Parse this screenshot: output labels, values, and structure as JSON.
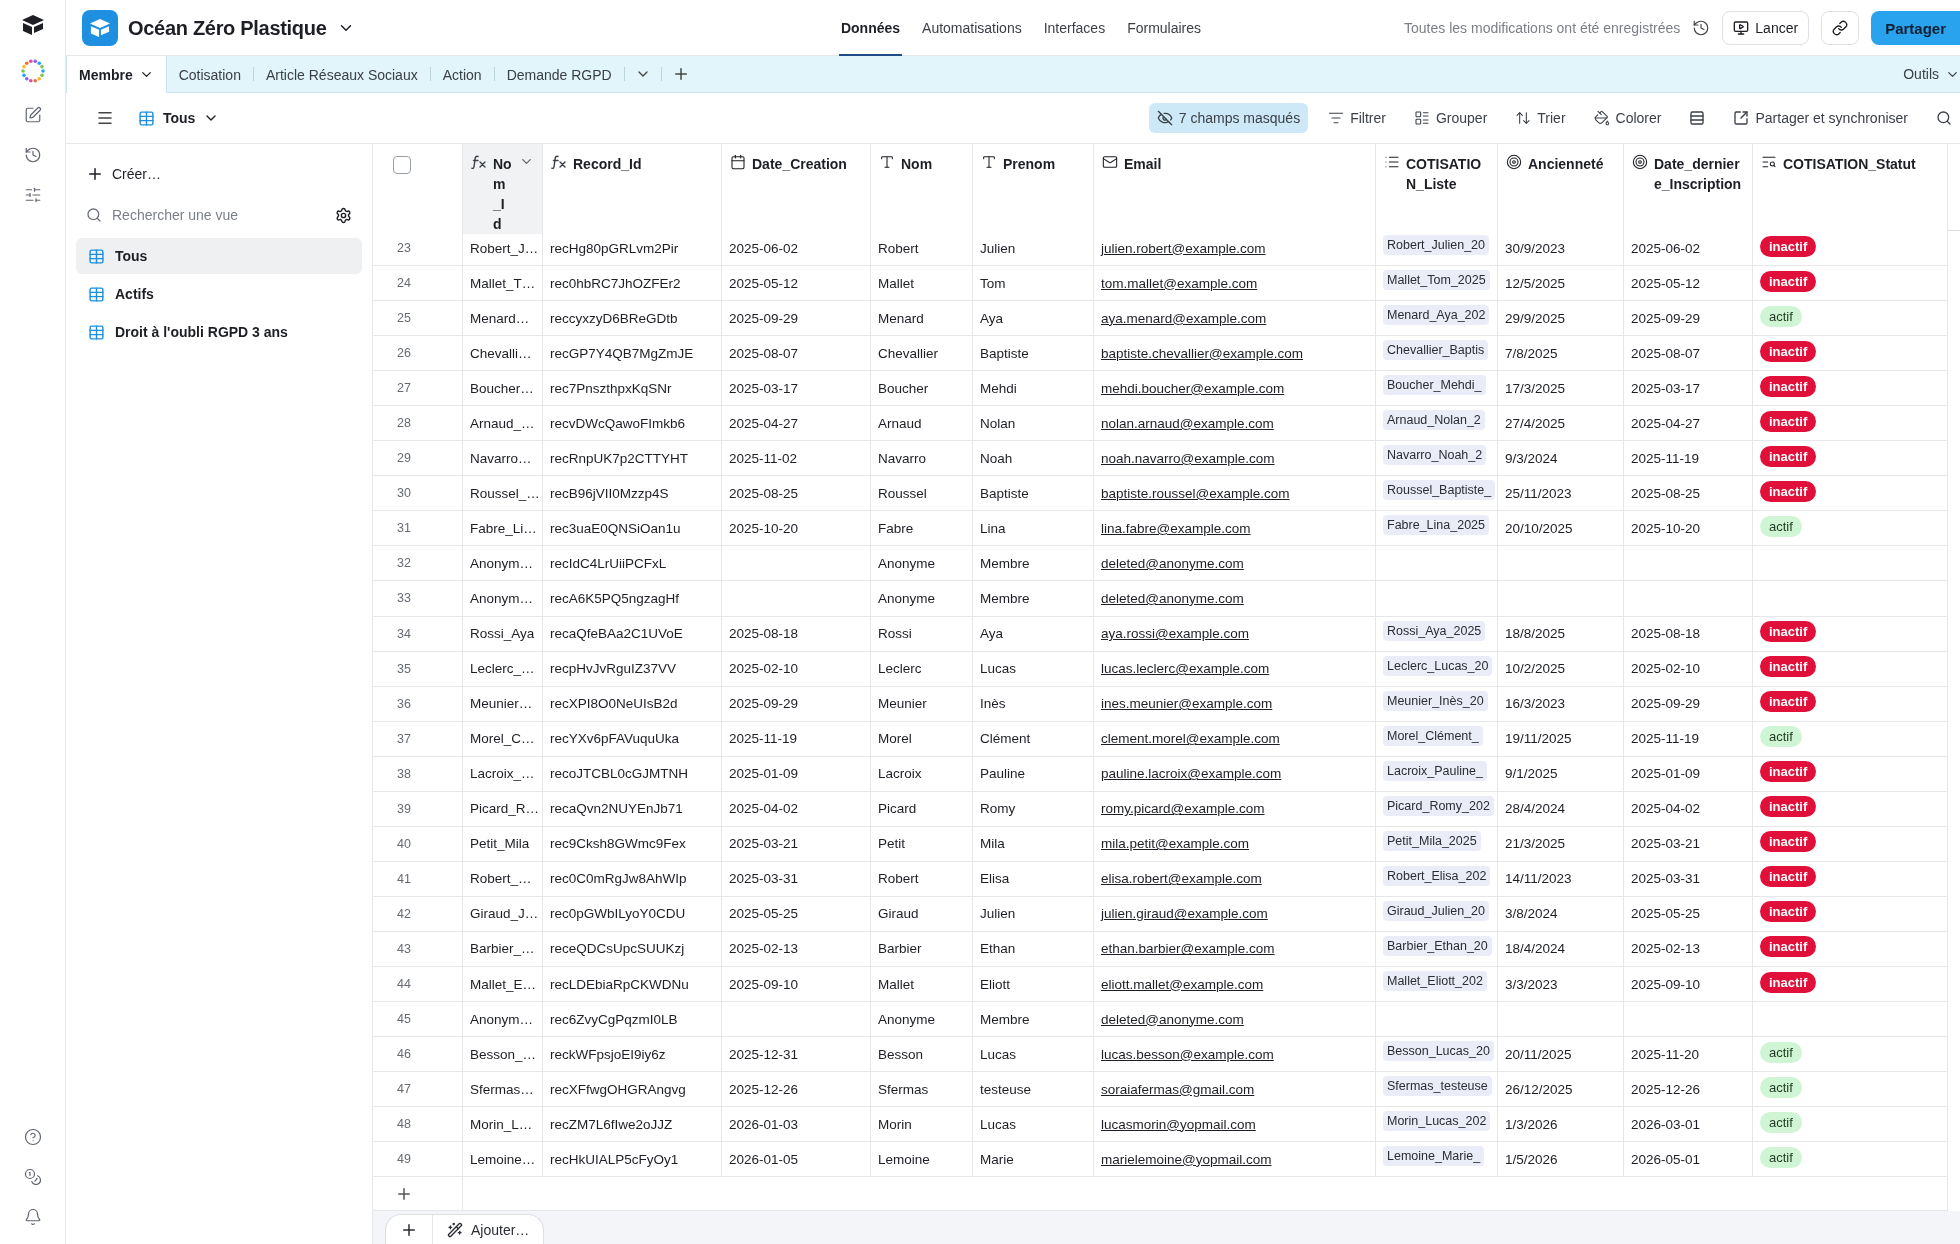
{
  "app": {
    "title": "Océan Zéro Plastique"
  },
  "nav": [
    {
      "label": "Données",
      "selected": true
    },
    {
      "label": "Automatisations",
      "selected": false
    },
    {
      "label": "Interfaces",
      "selected": false
    },
    {
      "label": "Formulaires",
      "selected": false
    }
  ],
  "save_status": "Toutes les modifications ont été enregistrées",
  "actions": {
    "launch": "Lancer",
    "share": "Partager"
  },
  "tables": [
    {
      "label": "Membre",
      "selected": true
    },
    {
      "label": "Cotisation",
      "selected": false
    },
    {
      "label": "Article Réseaux Sociaux",
      "selected": false
    },
    {
      "label": "Action",
      "selected": false
    },
    {
      "label": "Demande RGPD",
      "selected": false
    }
  ],
  "tools": "Outils",
  "view_toolbar": {
    "view": "Tous",
    "hidden_fields": "7 champs masqués",
    "buttons": [
      {
        "label": "Filtrer",
        "kind": "filter"
      },
      {
        "label": "Grouper",
        "kind": "group"
      },
      {
        "label": "Trier",
        "kind": "sort"
      },
      {
        "label": "Colorer",
        "kind": "color"
      }
    ],
    "sync": "Partager et synchroniser"
  },
  "sidebar": {
    "create": "Créer…",
    "search": {
      "placeholder": "Rechercher une vue"
    },
    "views": [
      {
        "label": "Tous",
        "selected": true
      },
      {
        "label": "Actifs",
        "selected": false
      },
      {
        "label": "Droit à l'oubli RGPD 3 ans",
        "selected": false
      }
    ]
  },
  "table": {
    "select_all_checked": false,
    "columns": [
      {
        "label": "Nom_Id",
        "kind": "formula",
        "highlighted": true
      },
      {
        "label": "Record_Id",
        "kind": "formula",
        "highlighted": false
      },
      {
        "label": "Date_Creation",
        "kind": "date",
        "highlighted": false
      },
      {
        "label": "Nom",
        "kind": "text",
        "highlighted": false
      },
      {
        "label": "Prenom",
        "kind": "text",
        "highlighted": false
      },
      {
        "label": "Email",
        "kind": "email",
        "highlighted": false
      },
      {
        "label": "COTISATION_Liste",
        "kind": "link",
        "highlighted": false
      },
      {
        "label": "Ancienneté",
        "kind": "rollup",
        "highlighted": false
      },
      {
        "label": "Date_derniere_Inscription",
        "kind": "rollup",
        "highlighted": false
      },
      {
        "label": "COTISATION_Statut",
        "kind": "lookup",
        "highlighted": false
      }
    ],
    "rows": [
      {
        "number": "23",
        "nom_id": "Robert_J…",
        "record_id": "recHg80pGRLvm2Pir",
        "date_creation": "2025-06-02",
        "nom": "Robert",
        "prenom": "Julien",
        "email": "julien.robert@example.com",
        "liste": "Robert_Julien_20",
        "anciennete": "30/9/2023",
        "date_derniere": "2025-06-02",
        "statut": {
          "label": "inactif",
          "color": "#e0103a"
        }
      },
      {
        "number": "24",
        "nom_id": "Mallet_T…",
        "record_id": "rec0hbRC7JhOZFEr2",
        "date_creation": "2025-05-12",
        "nom": "Mallet",
        "prenom": "Tom",
        "email": "tom.mallet@example.com",
        "liste": "Mallet_Tom_2025",
        "anciennete": "12/5/2025",
        "date_derniere": "2025-05-12",
        "statut": {
          "label": "inactif",
          "color": "#e0103a"
        }
      },
      {
        "number": "25",
        "nom_id": "Menard…",
        "record_id": "reccyxzyD6BReGDtb",
        "date_creation": "2025-09-29",
        "nom": "Menard",
        "prenom": "Aya",
        "email": "aya.menard@example.com",
        "liste": "Menard_Aya_202",
        "anciennete": "29/9/2025",
        "date_derniere": "2025-09-29",
        "statut": {
          "label": "actif",
          "color": "#cff5d4"
        }
      },
      {
        "number": "26",
        "nom_id": "Chevalli…",
        "record_id": "recGP7Y4QB7MgZmJE",
        "date_creation": "2025-08-07",
        "nom": "Chevallier",
        "prenom": "Baptiste",
        "email": "baptiste.chevallier@example.com",
        "liste": "Chevallier_Baptis",
        "anciennete": "7/8/2025",
        "date_derniere": "2025-08-07",
        "statut": {
          "label": "inactif",
          "color": "#e0103a"
        }
      },
      {
        "number": "27",
        "nom_id": "Boucher…",
        "record_id": "rec7PnszthpxKqSNr",
        "date_creation": "2025-03-17",
        "nom": "Boucher",
        "prenom": "Mehdi",
        "email": "mehdi.boucher@example.com",
        "liste": "Boucher_Mehdi_",
        "anciennete": "17/3/2025",
        "date_derniere": "2025-03-17",
        "statut": {
          "label": "inactif",
          "color": "#e0103a"
        }
      },
      {
        "number": "28",
        "nom_id": "Arnaud_…",
        "record_id": "recvDWcQawoFImkb6",
        "date_creation": "2025-04-27",
        "nom": "Arnaud",
        "prenom": "Nolan",
        "email": "nolan.arnaud@example.com",
        "liste": "Arnaud_Nolan_2",
        "anciennete": "27/4/2025",
        "date_derniere": "2025-04-27",
        "statut": {
          "label": "inactif",
          "color": "#e0103a"
        }
      },
      {
        "number": "29",
        "nom_id": "Navarro…",
        "record_id": "recRnpUK7p2CTTYHT",
        "date_creation": "2025-11-02",
        "nom": "Navarro",
        "prenom": "Noah",
        "email": "noah.navarro@example.com",
        "liste": "Navarro_Noah_2",
        "anciennete": "9/3/2024",
        "date_derniere": "2025-11-19",
        "statut": {
          "label": "inactif",
          "color": "#e0103a"
        }
      },
      {
        "number": "30",
        "nom_id": "Roussel_…",
        "record_id": "recB96jVII0Mzzp4S",
        "date_creation": "2025-08-25",
        "nom": "Roussel",
        "prenom": "Baptiste",
        "email": "baptiste.roussel@example.com",
        "liste": "Roussel_Baptiste_",
        "anciennete": "25/11/2023",
        "date_derniere": "2025-08-25",
        "statut": {
          "label": "inactif",
          "color": "#e0103a"
        }
      },
      {
        "number": "31",
        "nom_id": "Fabre_Li…",
        "record_id": "rec3uaE0QNSiOan1u",
        "date_creation": "2025-10-20",
        "nom": "Fabre",
        "prenom": "Lina",
        "email": "lina.fabre@example.com",
        "liste": "Fabre_Lina_2025",
        "anciennete": "20/10/2025",
        "date_derniere": "2025-10-20",
        "statut": {
          "label": "actif",
          "color": "#cff5d4"
        }
      },
      {
        "number": "32",
        "nom_id": "Anonym…",
        "record_id": "recIdC4LrUiiPCFxL",
        "nom": "Anonyme",
        "prenom": "Membre",
        "email": "deleted@anonyme.com"
      },
      {
        "number": "33",
        "nom_id": "Anonym…",
        "record_id": "recA6K5PQ5ngzagHf",
        "nom": "Anonyme",
        "prenom": "Membre",
        "email": "deleted@anonyme.com"
      },
      {
        "number": "34",
        "nom_id": "Rossi_Aya",
        "record_id": "recaQfeBAa2C1UVoE",
        "date_creation": "2025-08-18",
        "nom": "Rossi",
        "prenom": "Aya",
        "email": "aya.rossi@example.com",
        "liste": "Rossi_Aya_2025",
        "anciennete": "18/8/2025",
        "date_derniere": "2025-08-18",
        "statut": {
          "label": "inactif",
          "color": "#e0103a"
        }
      },
      {
        "number": "35",
        "nom_id": "Leclerc_…",
        "record_id": "recpHvJvRguIZ37VV",
        "date_creation": "2025-02-10",
        "nom": "Leclerc",
        "prenom": "Lucas",
        "email": "lucas.leclerc@example.com",
        "liste": "Leclerc_Lucas_20",
        "anciennete": "10/2/2025",
        "date_derniere": "2025-02-10",
        "statut": {
          "label": "inactif",
          "color": "#e0103a"
        }
      },
      {
        "number": "36",
        "nom_id": "Meunier…",
        "record_id": "recXPI8O0NeUIsB2d",
        "date_creation": "2025-09-29",
        "nom": "Meunier",
        "prenom": "Inès",
        "email": "ines.meunier@example.com",
        "liste": "Meunier_Inès_20",
        "anciennete": "16/3/2023",
        "date_derniere": "2025-09-29",
        "statut": {
          "label": "inactif",
          "color": "#e0103a"
        }
      },
      {
        "number": "37",
        "nom_id": "Morel_C…",
        "record_id": "recYXv6pFAVuquUka",
        "date_creation": "2025-11-19",
        "nom": "Morel",
        "prenom": "Clément",
        "email": "clement.morel@example.com",
        "liste": "Morel_Clément_",
        "anciennete": "19/11/2025",
        "date_derniere": "2025-11-19",
        "statut": {
          "label": "actif",
          "color": "#cff5d4"
        }
      },
      {
        "number": "38",
        "nom_id": "Lacroix_…",
        "record_id": "recoJTCBL0cGJMTNH",
        "date_creation": "2025-01-09",
        "nom": "Lacroix",
        "prenom": "Pauline",
        "email": "pauline.lacroix@example.com",
        "liste": "Lacroix_Pauline_",
        "anciennete": "9/1/2025",
        "date_derniere": "2025-01-09",
        "statut": {
          "label": "inactif",
          "color": "#e0103a"
        }
      },
      {
        "number": "39",
        "nom_id": "Picard_R…",
        "record_id": "recaQvn2NUYEnJb71",
        "date_creation": "2025-04-02",
        "nom": "Picard",
        "prenom": "Romy",
        "email": "romy.picard@example.com",
        "liste": "Picard_Romy_202",
        "anciennete": "28/4/2024",
        "date_derniere": "2025-04-02",
        "statut": {
          "label": "inactif",
          "color": "#e0103a"
        }
      },
      {
        "number": "40",
        "nom_id": "Petit_Mila",
        "record_id": "rec9Cksh8GWmc9Fex",
        "date_creation": "2025-03-21",
        "nom": "Petit",
        "prenom": "Mila",
        "email": "mila.petit@example.com",
        "liste": "Petit_Mila_2025",
        "anciennete": "21/3/2025",
        "date_derniere": "2025-03-21",
        "statut": {
          "label": "inactif",
          "color": "#e0103a"
        }
      },
      {
        "number": "41",
        "nom_id": "Robert_…",
        "record_id": "rec0C0mRgJw8AhWIp",
        "date_creation": "2025-03-31",
        "nom": "Robert",
        "prenom": "Elisa",
        "email": "elisa.robert@example.com",
        "liste": "Robert_Elisa_202",
        "anciennete": "14/11/2023",
        "date_derniere": "2025-03-31",
        "statut": {
          "label": "inactif",
          "color": "#e0103a"
        }
      },
      {
        "number": "42",
        "nom_id": "Giraud_J…",
        "record_id": "rec0pGWbILyoY0CDU",
        "date_creation": "2025-05-25",
        "nom": "Giraud",
        "prenom": "Julien",
        "email": "julien.giraud@example.com",
        "liste": "Giraud_Julien_20",
        "anciennete": "3/8/2024",
        "date_derniere": "2025-05-25",
        "statut": {
          "label": "inactif",
          "color": "#e0103a"
        }
      },
      {
        "number": "43",
        "nom_id": "Barbier_…",
        "record_id": "receQDCsUpcSUUKzj",
        "date_creation": "2025-02-13",
        "nom": "Barbier",
        "prenom": "Ethan",
        "email": "ethan.barbier@example.com",
        "liste": "Barbier_Ethan_20",
        "anciennete": "18/4/2024",
        "date_derniere": "2025-02-13",
        "statut": {
          "label": "inactif",
          "color": "#e0103a"
        }
      },
      {
        "number": "44",
        "nom_id": "Mallet_E…",
        "record_id": "recLDEbiaRpCKWDNu",
        "date_creation": "2025-09-10",
        "nom": "Mallet",
        "prenom": "Eliott",
        "email": "eliott.mallet@example.com",
        "liste": "Mallet_Eliott_202",
        "anciennete": "3/3/2023",
        "date_derniere": "2025-09-10",
        "statut": {
          "label": "inactif",
          "color": "#e0103a"
        }
      },
      {
        "number": "45",
        "nom_id": "Anonym…",
        "record_id": "rec6ZvyCgPqzmI0LB",
        "nom": "Anonyme",
        "prenom": "Membre",
        "email": "deleted@anonyme.com"
      },
      {
        "number": "46",
        "nom_id": "Besson_…",
        "record_id": "reckWFpsjoEI9iy6z",
        "date_creation": "2025-12-31",
        "nom": "Besson",
        "prenom": "Lucas",
        "email": "lucas.besson@example.com",
        "liste": "Besson_Lucas_20",
        "anciennete": "20/11/2025",
        "date_derniere": "2025-11-20",
        "statut": {
          "label": "actif",
          "color": "#cff5d4"
        }
      },
      {
        "number": "47",
        "nom_id": "Sfermas…",
        "record_id": "recXFfwgOHGRAngvg",
        "date_creation": "2025-12-26",
        "nom": "Sfermas",
        "prenom": "testeuse",
        "email": "soraiafermas@gmail.com",
        "liste": "Sfermas_testeuse",
        "anciennete": "26/12/2025",
        "date_derniere": "2025-12-26",
        "statut": {
          "label": "actif",
          "color": "#cff5d4"
        }
      },
      {
        "number": "48",
        "nom_id": "Morin_L…",
        "record_id": "recZM7L6fIwe2oJJZ",
        "date_creation": "2026-01-03",
        "nom": "Morin",
        "prenom": "Lucas",
        "email": "lucasmorin@yopmail.com",
        "liste": "Morin_Lucas_202",
        "anciennete": "1/3/2026",
        "date_derniere": "2026-03-01",
        "statut": {
          "label": "actif",
          "color": "#cff5d4"
        }
      },
      {
        "number": "49",
        "nom_id": "Lemoine…",
        "record_id": "recHkUIALP5cFyOy1",
        "date_creation": "2026-01-05",
        "nom": "Lemoine",
        "prenom": "Marie",
        "email": "marielemoine@yopmail.com",
        "liste": "Lemoine_Marie_",
        "anciennete": "1/5/2026",
        "date_derniere": "2026-05-01",
        "statut": {
          "label": "actif",
          "color": "#cff5d4"
        }
      }
    ]
  },
  "footer": {
    "add": "Ajouter…"
  }
}
